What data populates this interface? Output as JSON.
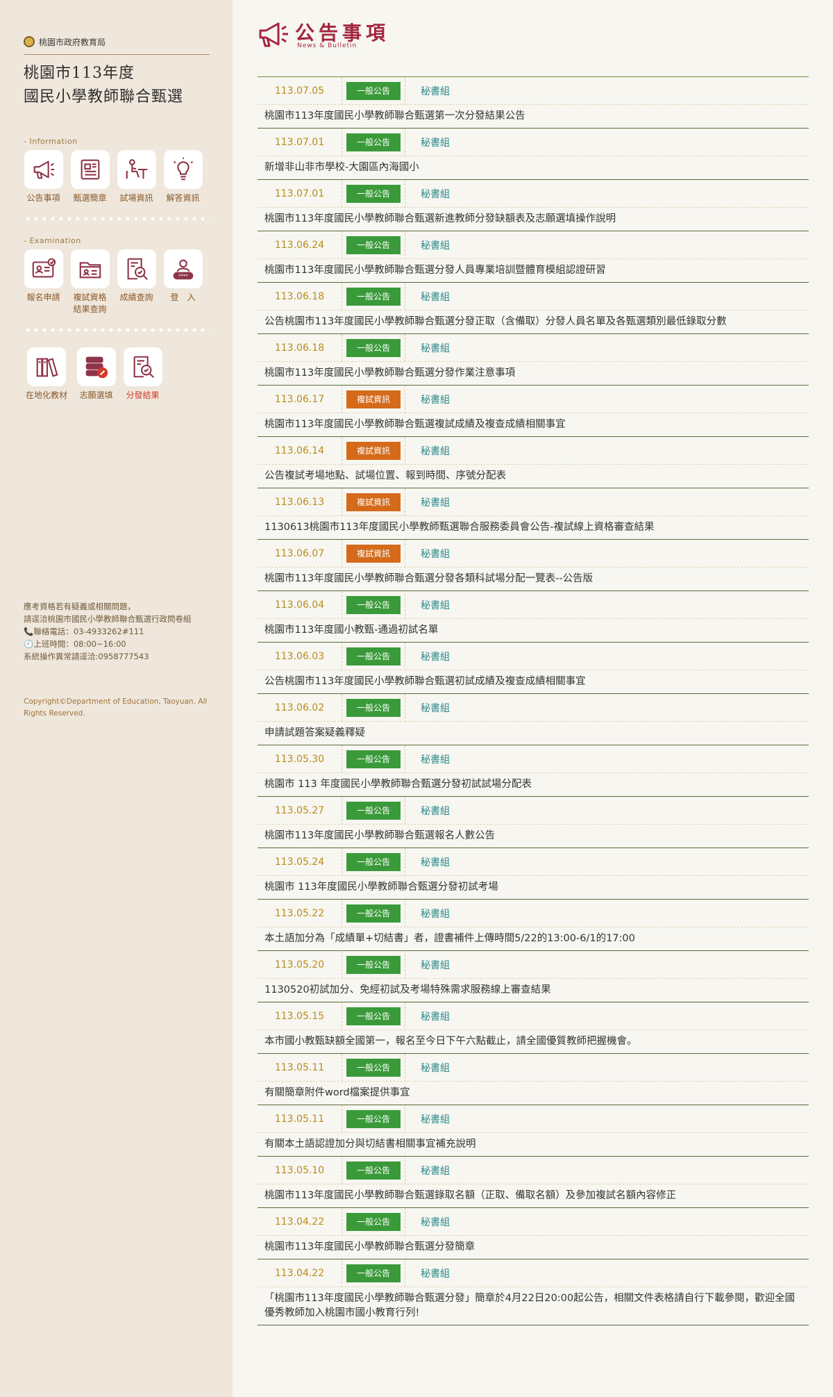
{
  "sidebar": {
    "brand": "桃園市政府教育局",
    "title_line1": "桃園市113年度",
    "title_line2": "國民小學教師聯合甄選",
    "info_label": "- Information",
    "exam_label": "- Examination",
    "info_items": [
      {
        "label": "公告事項",
        "icon": "megaphone-icon"
      },
      {
        "label": "甄選簡章",
        "icon": "document-icon"
      },
      {
        "label": "試場資訊",
        "icon": "desk-icon"
      },
      {
        "label": "解答資訊",
        "icon": "lightbulb-icon"
      }
    ],
    "exam_items": [
      {
        "label": "報名申請",
        "icon": "id-card-icon"
      },
      {
        "label": "複試資格\n結果查詢",
        "icon": "folder-icon"
      },
      {
        "label": "成績查詢",
        "icon": "search-report-icon"
      },
      {
        "label": "登　入",
        "icon": "user-login-icon"
      }
    ],
    "extra_items": [
      {
        "label": "在地化教材",
        "icon": "books-icon"
      },
      {
        "label": "志願選填",
        "icon": "server-edit-icon"
      },
      {
        "label": "分發結果",
        "icon": "result-search-icon"
      }
    ],
    "contact_lines": [
      "應考資格若有疑義或相關問題，",
      " 請逕洽桃園市國民小學教師聯合甄選行政問卷組",
      "📞聯絡電話：03-4933262#111",
      "🕘上班時間：08:00~16:00",
      "系統操作異常請逕洽:0958777543"
    ],
    "copyright": "Copyright©Department of Education, Taoyuan. All Rights Reserved."
  },
  "main": {
    "title": "公告事項",
    "subtitle": "News & Bulletin",
    "items": [
      {
        "date": "113.07.05",
        "tag": "一般公告",
        "tag_color": "#3a9a3a",
        "unit": "秘書組",
        "title": "桃園市113年度國民小學教師聯合甄選第一次分發結果公告"
      },
      {
        "date": "113.07.01",
        "tag": "一般公告",
        "tag_color": "#3a9a3a",
        "unit": "秘書組",
        "title": "新增非山非市學校-大園區內海國小"
      },
      {
        "date": "113.07.01",
        "tag": "一般公告",
        "tag_color": "#3a9a3a",
        "unit": "秘書組",
        "title": "桃園市113年度國民小學教師聯合甄選新進教師分發缺額表及志願選填操作說明"
      },
      {
        "date": "113.06.24",
        "tag": "一般公告",
        "tag_color": "#3a9a3a",
        "unit": "秘書組",
        "title": "桃園市113年度國民小學教師聯合甄選分發人員專業培訓暨體育模組認證研習"
      },
      {
        "date": "113.06.18",
        "tag": "一般公告",
        "tag_color": "#3a9a3a",
        "unit": "秘書組",
        "title": "公告桃園市113年度國民小學教師聯合甄選分發正取（含備取）分發人員名單及各甄選類別最低錄取分數"
      },
      {
        "date": "113.06.18",
        "tag": "一般公告",
        "tag_color": "#3a9a3a",
        "unit": "秘書組",
        "title": "桃園市113年度國民小學教師聯合甄選分發作業注意事項"
      },
      {
        "date": "113.06.17",
        "tag": "複試資訊",
        "tag_color": "#d46a1a",
        "unit": "秘書組",
        "title": "桃園市113年度國民小學教師聯合甄選複試成績及複查成績相關事宜"
      },
      {
        "date": "113.06.14",
        "tag": "複試資訊",
        "tag_color": "#d46a1a",
        "unit": "秘書組",
        "title": "公告複試考場地點、試場位置、報到時間、序號分配表"
      },
      {
        "date": "113.06.13",
        "tag": "複試資訊",
        "tag_color": "#d46a1a",
        "unit": "秘書組",
        "title": "1130613桃園市113年度國民小學教師甄選聯合服務委員會公告-複試線上資格審查結果"
      },
      {
        "date": "113.06.07",
        "tag": "複試資訊",
        "tag_color": "#d46a1a",
        "unit": "秘書組",
        "title": "桃園市113年度國民小學教師聯合甄選分發各類科試場分配一覽表--公告版"
      },
      {
        "date": "113.06.04",
        "tag": "一般公告",
        "tag_color": "#3a9a3a",
        "unit": "秘書組",
        "title": "桃園市113年度國小教甄-通過初試名單"
      },
      {
        "date": "113.06.03",
        "tag": "一般公告",
        "tag_color": "#3a9a3a",
        "unit": "秘書組",
        "title": "公告桃園市113年度國民小學教師聯合甄選初試成績及複查成績相關事宜"
      },
      {
        "date": "113.06.02",
        "tag": "一般公告",
        "tag_color": "#3a9a3a",
        "unit": "秘書組",
        "title": "申請試題答案疑義釋疑"
      },
      {
        "date": "113.05.30",
        "tag": "一般公告",
        "tag_color": "#3a9a3a",
        "unit": "秘書組",
        "title": "桃園市 113 年度國民小學教師聯合甄選分發初試試場分配表"
      },
      {
        "date": "113.05.27",
        "tag": "一般公告",
        "tag_color": "#3a9a3a",
        "unit": "秘書組",
        "title": "桃園市113年度國民小學教師聯合甄選報名人數公告"
      },
      {
        "date": "113.05.24",
        "tag": "一般公告",
        "tag_color": "#3a9a3a",
        "unit": "秘書組",
        "title": "桃園市 113年度國民小學教師聯合甄選分發初試考場"
      },
      {
        "date": "113.05.22",
        "tag": "一般公告",
        "tag_color": "#3a9a3a",
        "unit": "秘書組",
        "title": "本土語加分為「成績單+切結書」者，證書補件上傳時間5/22的13:00-6/1的17:00"
      },
      {
        "date": "113.05.20",
        "tag": "一般公告",
        "tag_color": "#3a9a3a",
        "unit": "秘書組",
        "title": "1130520初試加分、免經初試及考場特殊需求服務線上審查結果"
      },
      {
        "date": "113.05.15",
        "tag": "一般公告",
        "tag_color": "#3a9a3a",
        "unit": "秘書組",
        "title": "本市國小教甄缺額全國第一，報名至今日下午六點截止，請全國優質教師把握機會。"
      },
      {
        "date": "113.05.11",
        "tag": "一般公告",
        "tag_color": "#3a9a3a",
        "unit": "秘書組",
        "title": "有關簡章附件word檔案提供事宜"
      },
      {
        "date": "113.05.11",
        "tag": "一般公告",
        "tag_color": "#3a9a3a",
        "unit": "秘書組",
        "title": "有關本土語認證加分與切結書相關事宜補充說明"
      },
      {
        "date": "113.05.10",
        "tag": "一般公告",
        "tag_color": "#3a9a3a",
        "unit": "秘書組",
        "title": "桃園市113年度國民小學教師聯合甄選錄取名額（正取、備取名額）及參加複試名額內容修正"
      },
      {
        "date": "113.04.22",
        "tag": "一般公告",
        "tag_color": "#3a9a3a",
        "unit": "秘書組",
        "title": "桃園市113年度國民小學教師聯合甄選分發簡章"
      },
      {
        "date": "113.04.22",
        "tag": "一般公告",
        "tag_color": "#3a9a3a",
        "unit": "秘書組",
        "title": "「桃園市113年度國民小學教師聯合甄選分發」簡章於4月22日20:00起公告，相關文件表格請自行下載參閱，歡迎全國優秀教師加入桃園市國小教育行列!"
      }
    ]
  },
  "colors": {
    "sidebar_bg": "#efe7dc",
    "accent_title": "#a4263f",
    "badge_general": "#3a9a3a",
    "badge_retest": "#d46a1a",
    "date_text": "#b88c1c",
    "unit_text": "#2a8a8a",
    "active_nav": "#d23b2a"
  }
}
